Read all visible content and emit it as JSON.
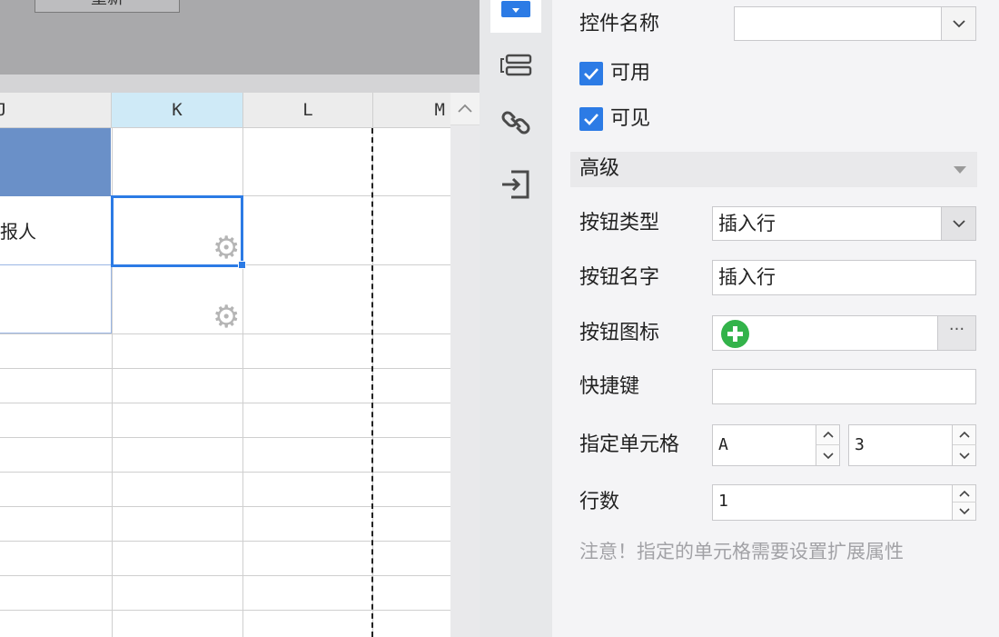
{
  "top_stub_label": "重新",
  "sheet": {
    "columns": [
      "J",
      "K",
      "L",
      "M"
    ],
    "selected_column": "K",
    "cell_text": "报人"
  },
  "toolbar": {
    "items": [
      {
        "name": "widget-settings-icon",
        "active": true
      },
      {
        "name": "form-layout-icon",
        "active": false
      },
      {
        "name": "link-icon",
        "active": false
      },
      {
        "name": "import-icon",
        "active": false
      }
    ]
  },
  "panel": {
    "widget_name_label": "控件名称",
    "widget_name_value": "",
    "enabled_label": "可用",
    "enabled_checked": true,
    "visible_label": "可见",
    "visible_checked": true,
    "advanced_label": "高级",
    "button_type_label": "按钮类型",
    "button_type_value": "插入行",
    "button_name_label": "按钮名字",
    "button_name_value": "插入行",
    "button_icon_label": "按钮图标",
    "button_icon_more": "···",
    "shortcut_label": "快捷键",
    "shortcut_value": "",
    "target_cell_label": "指定单元格",
    "target_cell_column": "A",
    "target_cell_row": "3",
    "row_count_label": "行数",
    "row_count_value": "1",
    "note": "注意！指定的单元格需要设置扩展属性"
  },
  "colors": {
    "accent": "#2c7be5",
    "plus_green": "#33b34a",
    "header_fill": "#6a90c8",
    "selected_col_header": "#cfeaf7"
  }
}
